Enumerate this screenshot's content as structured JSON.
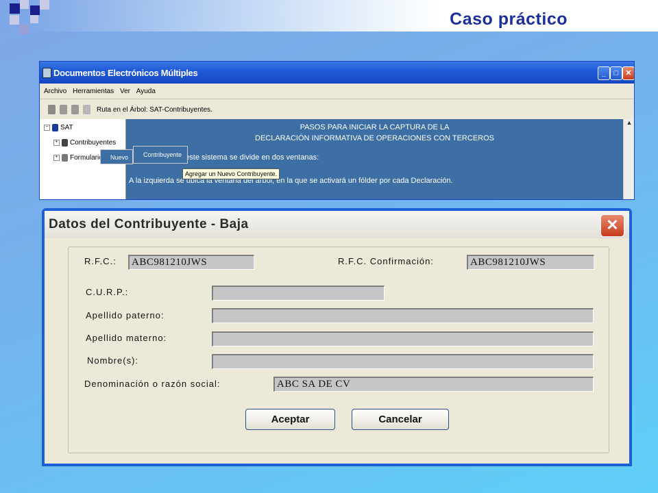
{
  "slide": {
    "title": "Caso práctico"
  },
  "app": {
    "title": "Documentos Electrónicos Múltiples",
    "window_buttons": [
      "_",
      "□",
      "✕"
    ],
    "menu": [
      "Archivo",
      "Herramientas",
      "Ver",
      "Ayuda"
    ],
    "toolbar_path": "Ruta en el Árbol: SAT-Contribuyentes.",
    "tree": {
      "root": "SAT",
      "items": [
        "Contribuyentes",
        "Formularios"
      ]
    },
    "context_menu": {
      "item": "Nuevo",
      "submenu": "Contribuyente"
    },
    "tooltip": "Agregar un Nuevo Contribuyente.",
    "content": {
      "heading_1": "PASOS PARA INICIAR LA CAPTURA DE LA",
      "heading_2": "DECLARACIÓN INFORMATIVA DE OPERACIONES CON TERCEROS",
      "line_1": "La pantalla de este sistema se divide en dos ventanas:",
      "line_2": "A la izquierda se ubica la ventana del árbol, en la que se activará un fólder por cada Declaración."
    }
  },
  "dialog": {
    "title": "Datos del Contribuyente - Baja",
    "close_label": "✕",
    "fields": {
      "rfc_label": "R.F.C.:",
      "rfc_value": "ABC981210JWS",
      "rfc_conf_label": "R.F.C. Confirmación:",
      "rfc_conf_value": "ABC981210JWS",
      "curp_label": "C.U.R.P.:",
      "curp_value": "",
      "paterno_label": "Apellido paterno:",
      "paterno_value": "",
      "materno_label": "Apellido materno:",
      "materno_value": "",
      "nombre_label": "Nombre(s):",
      "nombre_value": "",
      "razon_label": "Denominación o razón social:",
      "razon_value": "ABC SA DE CV"
    },
    "buttons": {
      "accept": "Aceptar",
      "cancel": "Cancelar"
    }
  }
}
